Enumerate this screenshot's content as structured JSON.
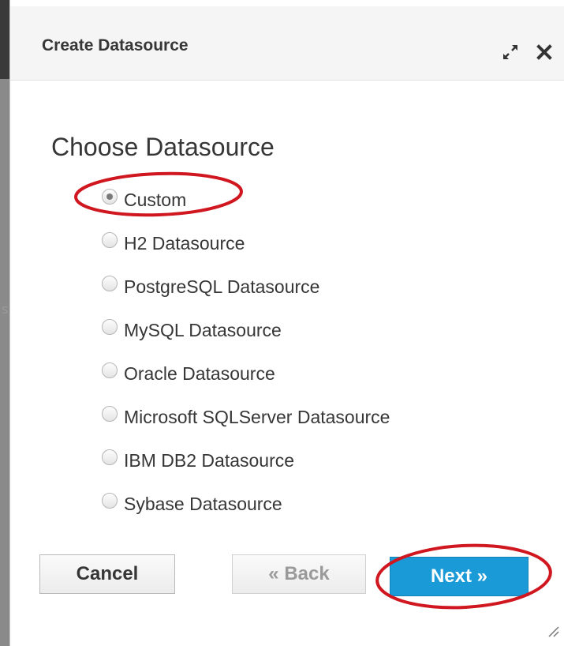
{
  "dialog": {
    "title": "Create Datasource"
  },
  "header_icons": [
    "maximize-icon",
    "close-icon"
  ],
  "section": {
    "title": "Choose Datasource"
  },
  "options": [
    {
      "label": "Custom",
      "checked": true
    },
    {
      "label": "H2 Datasource",
      "checked": false
    },
    {
      "label": "PostgreSQL Datasource",
      "checked": false
    },
    {
      "label": "MySQL Datasource",
      "checked": false
    },
    {
      "label": "Oracle Datasource",
      "checked": false
    },
    {
      "label": "Microsoft SQLServer Datasource",
      "checked": false
    },
    {
      "label": "IBM DB2 Datasource",
      "checked": false
    },
    {
      "label": "Sybase Datasource",
      "checked": false
    }
  ],
  "buttons": {
    "cancel": "Cancel",
    "back": "« Back",
    "next": "Next »"
  },
  "colors": {
    "primary_button": "#1a9ad6",
    "annotation": "#d0161f"
  },
  "backdrop": {
    "partial_char": "s"
  }
}
